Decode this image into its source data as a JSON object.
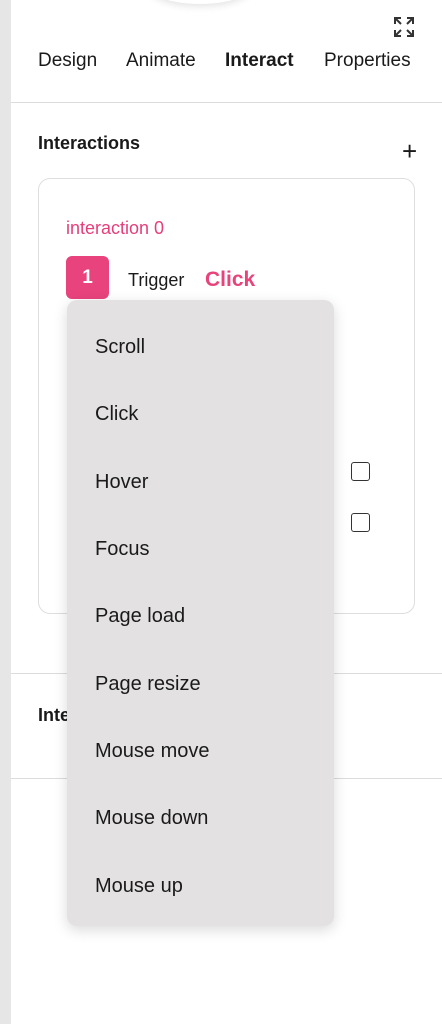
{
  "tabs": [
    "Design",
    "Animate",
    "Interact",
    "Properties"
  ],
  "active_tab": "Interact",
  "interactions": {
    "title": "Interactions",
    "add_label": "+",
    "item": {
      "name": "interaction 0",
      "step": "1",
      "trigger_label": "Trigger",
      "trigger_value": "Click"
    }
  },
  "section2": {
    "title_visible": "Inte"
  },
  "trigger_menu": {
    "options": [
      "Scroll",
      "Click",
      "Hover",
      "Focus",
      "Page load",
      "Page resize",
      "Mouse move",
      "Mouse down",
      "Mouse up"
    ]
  },
  "colors": {
    "accent": "#e8437c",
    "accent_text": "#e53e7b",
    "menu_bg": "#e3e1e1"
  },
  "icons": {
    "expand": "expand-icon",
    "add": "plus-icon"
  }
}
